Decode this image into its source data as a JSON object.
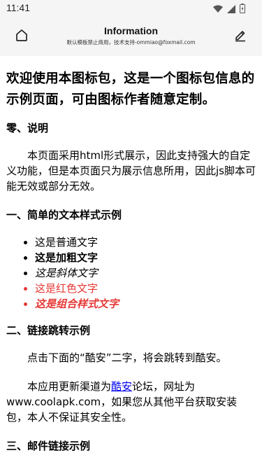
{
  "status_bar": {
    "time": "11:41",
    "icons": [
      "wifi-icon",
      "signal-icon",
      "battery-icon"
    ]
  },
  "app_bar": {
    "title": "Information",
    "subtitle": "默认模板禁止商用，技术支持-ommiao@foxmail.com",
    "left_icon": "home-icon",
    "right_icon": "edit-icon"
  },
  "content": {
    "headline": "欢迎使用本图标包，这是一个图标包信息的示例页面，可由图标作者随意定制。",
    "section0": {
      "title": "零、说明",
      "body": "本页面采用html形式展示，因此支持强大的自定义功能，但是本页面只为展示信息所用，因此js脚本可能无效或部分无效。"
    },
    "section1": {
      "title": "一、简单的文本样式示例",
      "items": {
        "normal": "这是普通文字",
        "bold": "这是加粗文字",
        "italic_prefix": "这是",
        "italic_part": "斜体",
        "italic_suffix": "文字",
        "red": "这是红色文字",
        "combo": "这是组合样式文字"
      }
    },
    "section2": {
      "title": "二、链接跳转示例",
      "para1": "点击下面的“酷安”二字，将会跳转到酷安。",
      "para2_prefix": "本应用更新渠道为",
      "para2_link": "酷安",
      "para2_suffix": "论坛，网址为www.coolapk.com，如果您从其他平台获取安装包，本人不保证其安全性。"
    },
    "section3": {
      "title": "三、邮件链接示例"
    }
  },
  "colors": {
    "bar_background": "#f5f5f5",
    "red_text": "#e53935",
    "link": "#0000ee"
  }
}
